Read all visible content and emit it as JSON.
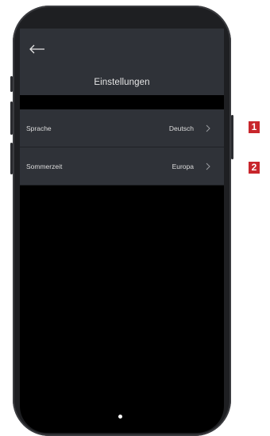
{
  "header": {
    "back_icon": "back-arrow-icon",
    "title": "Einstellungen"
  },
  "settings": [
    {
      "label": "Sprache",
      "value": "Deutsch",
      "icon": "chevron-right-icon"
    },
    {
      "label": "Sommerzeit",
      "value": "Europa",
      "icon": "chevron-right-icon"
    }
  ],
  "markers": [
    "1",
    "2"
  ],
  "colors": {
    "screen_background": "#000000",
    "panel_background": "#2f3238",
    "text": "#dcdcdc",
    "marker": "#c8262c"
  }
}
